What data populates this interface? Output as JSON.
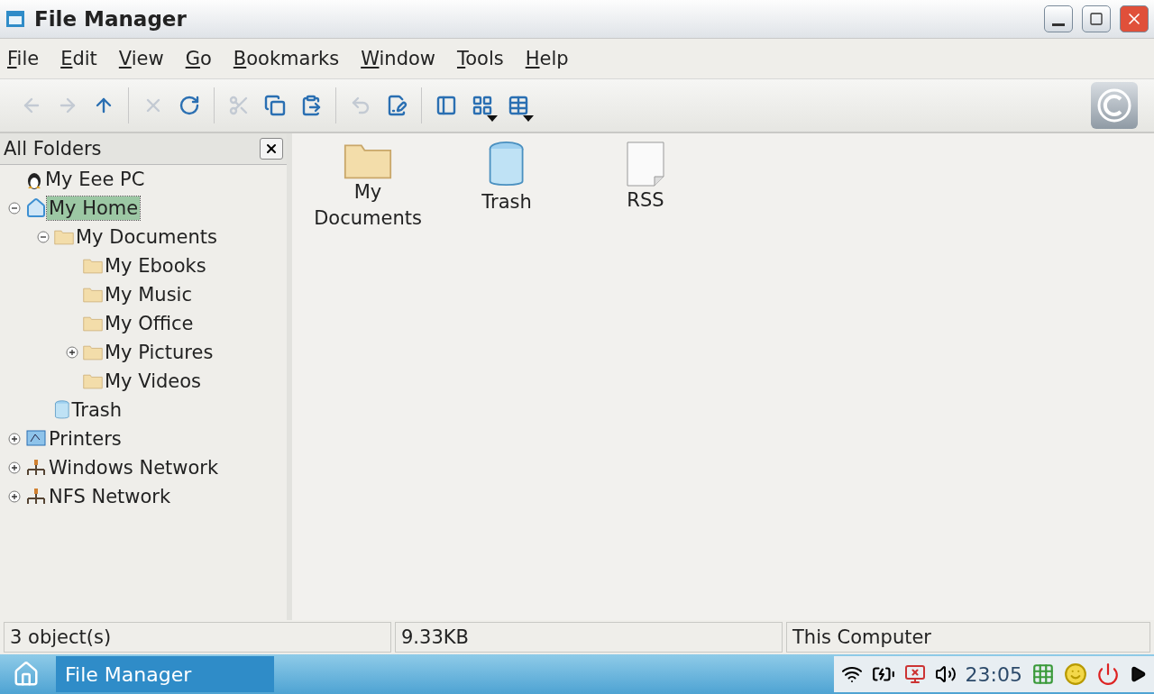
{
  "window": {
    "title": "File Manager"
  },
  "menu": [
    "File",
    "Edit",
    "View",
    "Go",
    "Bookmarks",
    "Window",
    "Tools",
    "Help"
  ],
  "toolbar": [
    {
      "kind": "back",
      "disabled": true
    },
    {
      "kind": "forward",
      "disabled": true
    },
    {
      "kind": "up",
      "disabled": false
    },
    {
      "kind": "sep"
    },
    {
      "kind": "stop",
      "disabled": true
    },
    {
      "kind": "refresh",
      "disabled": false
    },
    {
      "kind": "sep"
    },
    {
      "kind": "cut",
      "disabled": true
    },
    {
      "kind": "copy",
      "disabled": false
    },
    {
      "kind": "paste",
      "disabled": false
    },
    {
      "kind": "sep"
    },
    {
      "kind": "undo",
      "disabled": true
    },
    {
      "kind": "properties",
      "disabled": false
    },
    {
      "kind": "sep"
    },
    {
      "kind": "sidebar",
      "disabled": false
    },
    {
      "kind": "icons",
      "disabled": false,
      "dropdown": true
    },
    {
      "kind": "details",
      "disabled": false,
      "dropdown": true
    }
  ],
  "folder_pane": {
    "title": "All Folders",
    "tree": [
      {
        "kind": "computer",
        "label": "My Eee PC",
        "selected": false
      },
      {
        "kind": "home",
        "label": "My Home",
        "selected": true,
        "expanded": true,
        "children": [
          {
            "kind": "folder",
            "label": "My Documents",
            "selected": false,
            "expanded": true,
            "children": [
              {
                "kind": "folder",
                "label": "My Ebooks",
                "selected": false
              },
              {
                "kind": "folder",
                "label": "My Music",
                "selected": false
              },
              {
                "kind": "folder",
                "label": "My Office",
                "selected": false
              },
              {
                "kind": "folder",
                "label": "My Pictures",
                "selected": false,
                "expanded": false
              },
              {
                "kind": "folder",
                "label": "My Videos",
                "selected": false
              }
            ]
          },
          {
            "kind": "trash",
            "label": "Trash",
            "selected": false
          }
        ]
      },
      {
        "kind": "printers",
        "label": "Printers",
        "selected": false,
        "expanded": false
      },
      {
        "kind": "network",
        "label": "Windows Network",
        "selected": false,
        "expanded": false
      },
      {
        "kind": "network",
        "label": "NFS Network",
        "selected": false,
        "expanded": false
      }
    ]
  },
  "files": [
    {
      "kind": "folder",
      "name": "My Documents"
    },
    {
      "kind": "trash",
      "name": "Trash"
    },
    {
      "kind": "document",
      "name": "RSS"
    }
  ],
  "status_bar": {
    "count": "3 object(s)",
    "size": "9.33KB",
    "location": "This Computer"
  },
  "taskbar": {
    "task": "File Manager",
    "clock": "23:05"
  }
}
